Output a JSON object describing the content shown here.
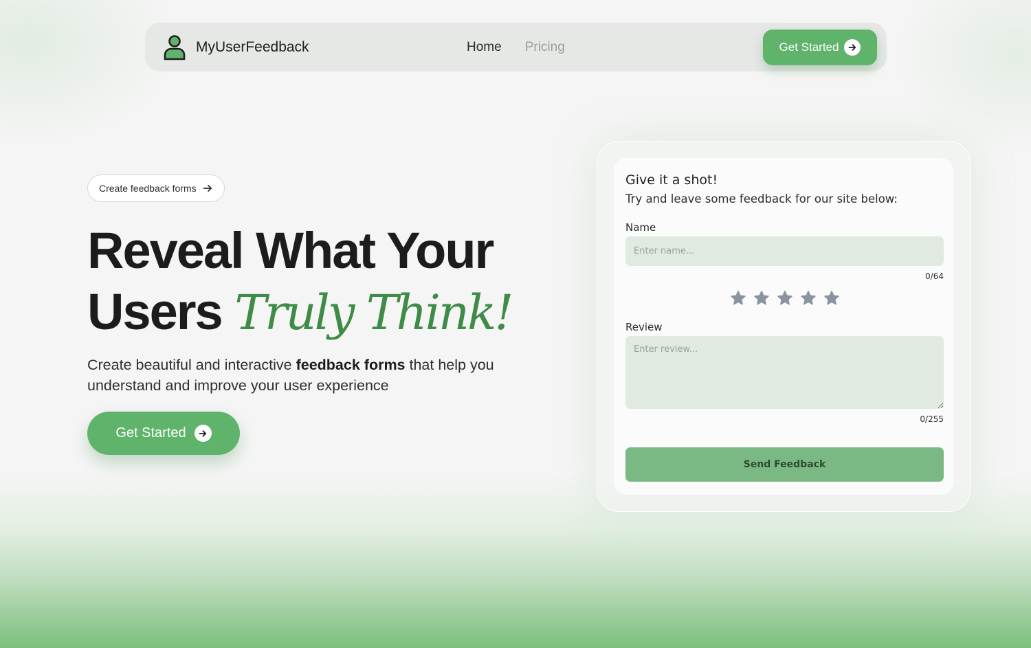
{
  "nav": {
    "brand": "MyUserFeedback",
    "brand_icon": "user-icon",
    "links": [
      {
        "label": "Home",
        "state": "active"
      },
      {
        "label": "Pricing",
        "state": "muted"
      }
    ],
    "cta_label": "Get Started",
    "cta_icon": "arrow-right-icon"
  },
  "hero": {
    "pill_label": "Create feedback forms",
    "pill_icon": "arrow-right-icon",
    "headline_line1": "Reveal What Your",
    "headline_line2_plain": "Users",
    "headline_line2_accent": "Truly Think!",
    "subtext_before": "Create beautiful and interactive",
    "subtext_bold": "feedback forms",
    "subtext_after": "that help you understand and improve your user experience",
    "cta_label": "Get Started",
    "cta_icon": "arrow-right-icon"
  },
  "form": {
    "title": "Give it a shot!",
    "subtitle": "Try and leave some feedback for our site below:",
    "name_label": "Name",
    "name_placeholder": "Enter name...",
    "name_counter": "0/64",
    "rating": {
      "selected": 0,
      "max": 5,
      "icon": "star-icon"
    },
    "review_label": "Review",
    "review_placeholder": "Enter review...",
    "review_counter": "0/255",
    "submit_label": "Send Feedback"
  },
  "colors": {
    "accent_green": "#5fb36a",
    "headline_accent": "#3f8b48",
    "input_bg": "#e0eae0",
    "submit_bg": "#7bb984",
    "star_inactive": "#8a93a0"
  }
}
